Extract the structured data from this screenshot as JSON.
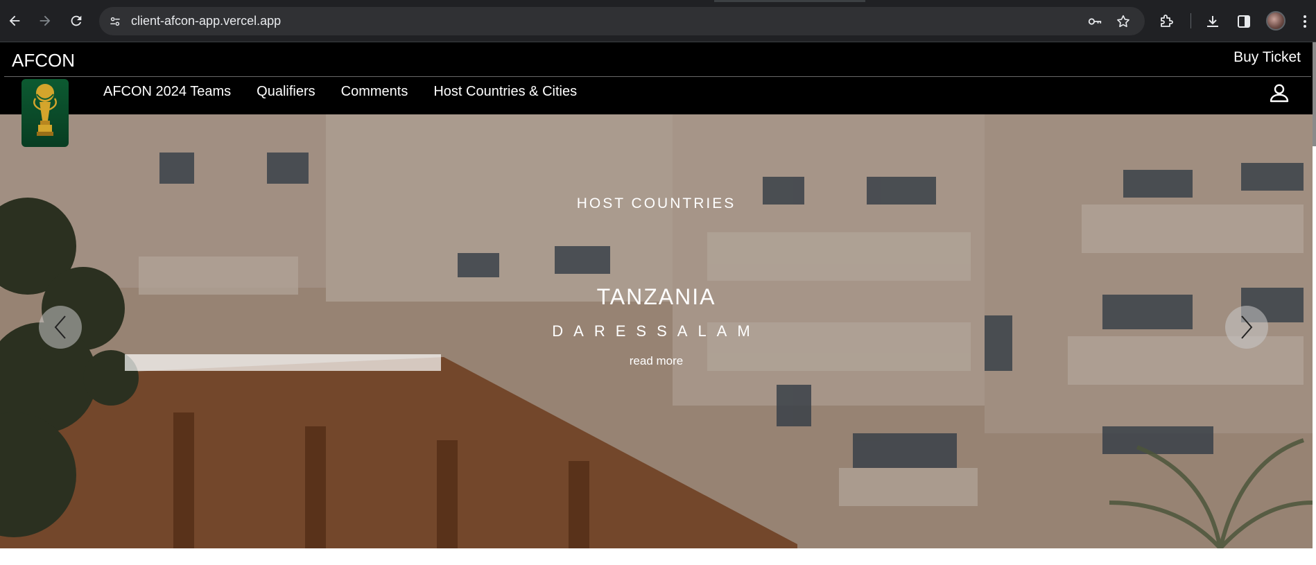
{
  "browser": {
    "url": "client-afcon-app.vercel.app"
  },
  "header": {
    "brand": "AFCON",
    "buy_ticket": "Buy Ticket",
    "nav": [
      {
        "label": "AFCON 2024 Teams"
      },
      {
        "label": "Qualifiers"
      },
      {
        "label": "Comments"
      },
      {
        "label": "Host Countries & Cities"
      }
    ]
  },
  "hero": {
    "kicker": "HOST COUNTRIES",
    "country": "TANZANIA",
    "city": "DARESSALAM",
    "read_more": "read more"
  },
  "colors": {
    "header_bg": "#000000",
    "chrome_bg": "#202124",
    "omnibox_bg": "#303134",
    "logo_green": "#0c5a31",
    "trophy_gold": "#d4a52c"
  },
  "icons": {
    "back": "arrow-left-icon",
    "forward": "arrow-right-icon",
    "reload": "reload-icon",
    "site_info": "tune-icon",
    "password": "key-icon",
    "bookmark": "star-icon",
    "extensions": "puzzle-icon",
    "downloads": "download-icon",
    "side_panel": "side-panel-icon",
    "menu": "kebab-menu-icon",
    "user": "user-icon",
    "prev": "chevron-left-icon",
    "next": "chevron-right-icon"
  }
}
